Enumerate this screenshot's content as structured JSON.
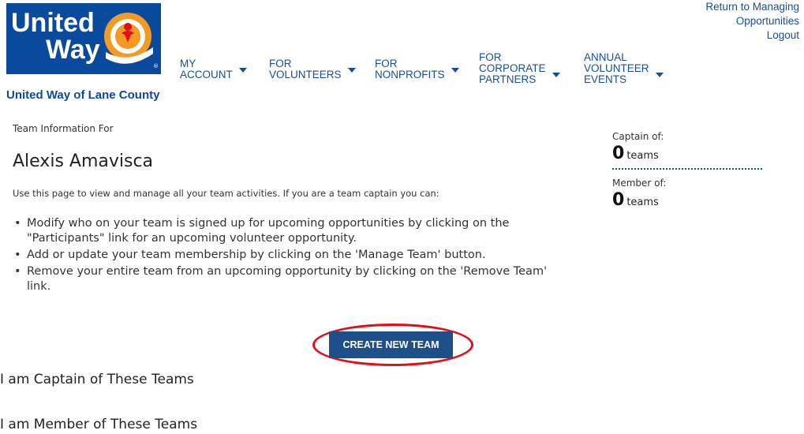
{
  "brand": {
    "logo_line1": "United",
    "logo_line2": "Way",
    "caption": "United Way of Lane County",
    "primary_color": "#0a4a9c",
    "accent_color": "#f29a24"
  },
  "top_links": {
    "return_link": "Return to Managing Opportunities",
    "logout_link": "Logout"
  },
  "nav": [
    {
      "label": "MY\nACCOUNT"
    },
    {
      "label": "FOR\nVOLUNTEERS"
    },
    {
      "label": "FOR\nNONPROFITS"
    },
    {
      "label": "FOR\nCORPORATE\nPARTNERS"
    },
    {
      "label": "ANNUAL\nVOLUNTEER\nEVENTS"
    }
  ],
  "page": {
    "team_info_for": "Team Information For",
    "user_name": "Alexis Amavisca",
    "intro": "Use this page to view and manage all your team activities. If you are a team captain you can:",
    "bullets": [
      "Modify who on your team is signed up for upcoming opportunities by clicking on the \"Participants\" link for an upcoming volunteer opportunity.",
      "Add or update your team membership by clicking on the 'Manage Team' button.",
      "Remove your entire team from an upcoming opportunity by clicking on the 'Remove Team' link."
    ],
    "create_team_button": "CREATE NEW TEAM",
    "captain_section_title": "I am Captain of These Teams",
    "member_section_title": "I am Member of These Teams"
  },
  "stats": {
    "captain_label": "Captain of:",
    "captain_count": "0",
    "captain_unit": "teams",
    "member_label": "Member of:",
    "member_count": "0",
    "member_unit": "teams"
  },
  "highlight_color": "#e0101a"
}
